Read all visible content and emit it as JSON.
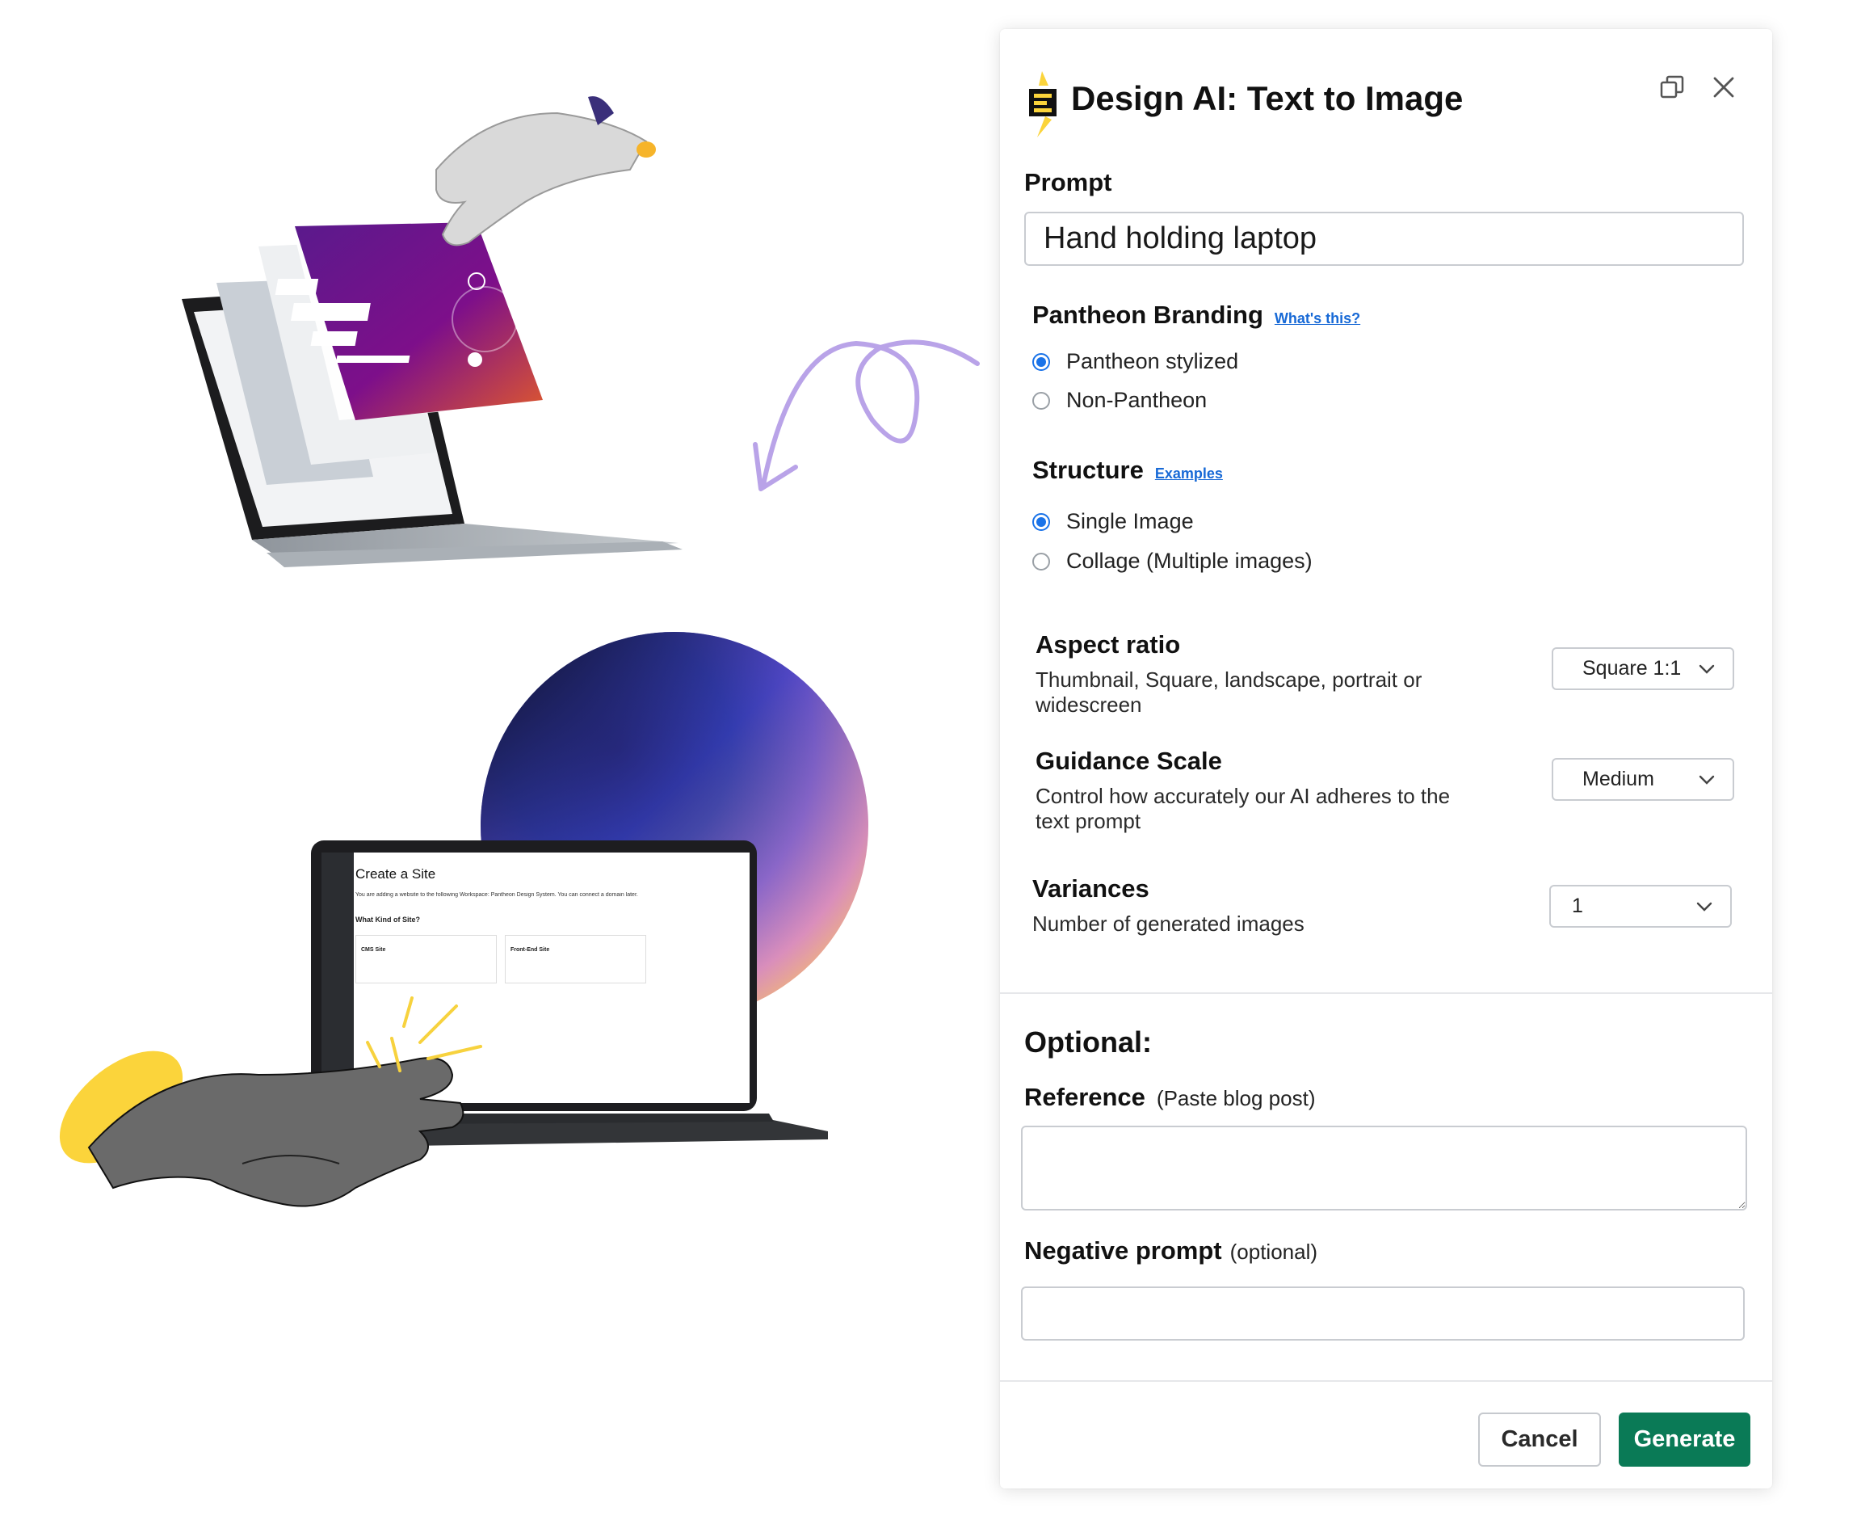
{
  "dialog": {
    "title": "Design AI: Text to Image",
    "prompt": {
      "label": "Prompt",
      "value": "Hand holding laptop"
    },
    "branding": {
      "label": "Pantheon Branding",
      "help_link": "What's this?",
      "options": [
        {
          "label": "Pantheon stylized",
          "selected": true
        },
        {
          "label": "Non-Pantheon",
          "selected": false
        }
      ]
    },
    "structure": {
      "label": "Structure",
      "help_link": "Examples",
      "options": [
        {
          "label": "Single Image",
          "selected": true
        },
        {
          "label": "Collage (Multiple images)",
          "selected": false
        }
      ]
    },
    "aspect_ratio": {
      "label": "Aspect ratio",
      "description": "Thumbnail, Square, landscape, portrait or widescreen",
      "value": "Square 1:1"
    },
    "guidance_scale": {
      "label": "Guidance Scale",
      "description": "Control how accurately our AI adheres to the text prompt",
      "value": "Medium"
    },
    "variances": {
      "label": "Variances",
      "description": "Number of generated images",
      "value": "1"
    },
    "optional": {
      "heading": "Optional:",
      "reference_label": "Reference",
      "reference_hint": "(Paste blog post)",
      "reference_value": "",
      "negative_label": "Negative prompt",
      "negative_hint": "(optional)",
      "negative_value": ""
    },
    "buttons": {
      "cancel": "Cancel",
      "generate": "Generate"
    }
  },
  "illustration": {
    "screen_title": "Create a Site",
    "screen_subtitle": "You are adding a website to the following Workspace: Pantheon Design System. You can connect a domain later.",
    "screen_question": "What Kind of Site?",
    "card1_title": "CMS Site",
    "card2_title": "Front-End Site"
  },
  "colors": {
    "accent_blue": "#1a73e8",
    "generate_green": "#0a7a56",
    "link_blue": "#1769d6",
    "pantheon_yellow": "#fbd43b",
    "arrow_lavender": "#b9a3e8"
  }
}
